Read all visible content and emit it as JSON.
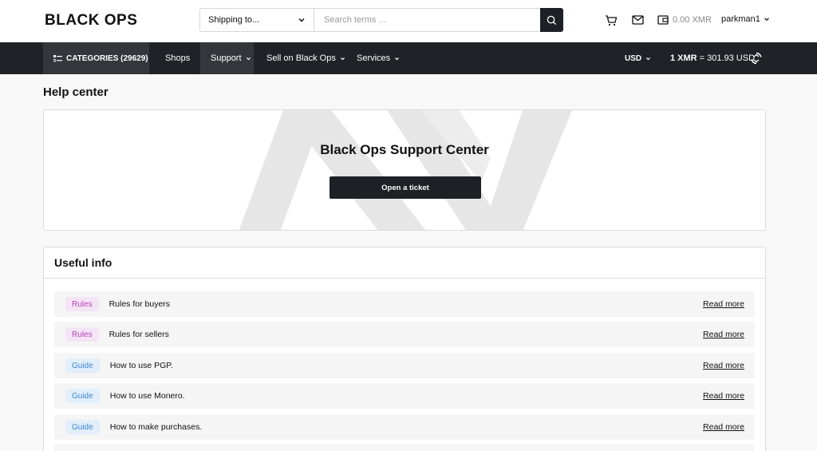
{
  "header": {
    "logo_text": "BLACK OPS",
    "shipping_label": "Shipping to...",
    "search_placeholder": "Search terms ...",
    "wallet_balance": "0.00 XMR",
    "username": "parkman1"
  },
  "nav": {
    "categories_label": "CATEGORIES (29629)",
    "items": [
      {
        "label": "Shops"
      },
      {
        "label": "Support"
      },
      {
        "label": "Sell on Black Ops"
      },
      {
        "label": "Services"
      }
    ],
    "currency": "USD",
    "rate_prefix": "1 XMR",
    "rate_value": "= 301.93 USD"
  },
  "page": {
    "title": "Help center",
    "hero_title": "Black Ops Support Center",
    "ticket_button": "Open a ticket",
    "useful_info_title": "Useful info",
    "read_more": "Read more",
    "rows": [
      {
        "badge": "Rules",
        "title": "Rules for buyers"
      },
      {
        "badge": "Rules",
        "title": "Rules for sellers"
      },
      {
        "badge": "Guide",
        "title": "How to use PGP."
      },
      {
        "badge": "Guide",
        "title": "How to use Monero."
      },
      {
        "badge": "Guide",
        "title": "How to make purchases."
      }
    ]
  },
  "colors": {
    "nav_bg": "#1f2226",
    "active_bg": "#33373c",
    "rules_badge": "#b642c0",
    "guide_badge": "#3e86d0"
  }
}
